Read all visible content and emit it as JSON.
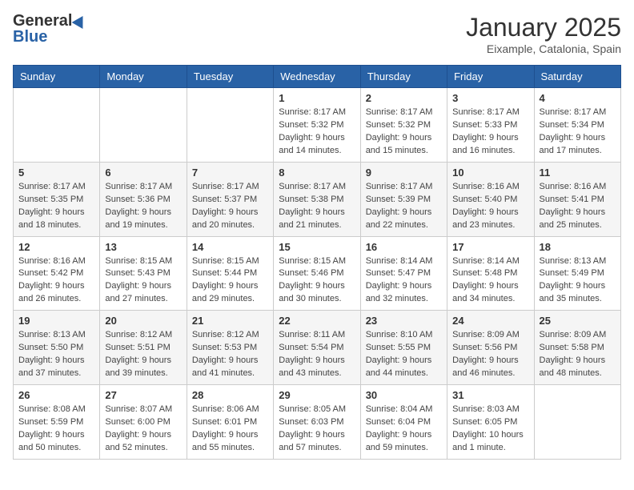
{
  "logo": {
    "general": "General",
    "blue": "Blue"
  },
  "header": {
    "month": "January 2025",
    "location": "Eixample, Catalonia, Spain"
  },
  "weekdays": [
    "Sunday",
    "Monday",
    "Tuesday",
    "Wednesday",
    "Thursday",
    "Friday",
    "Saturday"
  ],
  "weeks": [
    [
      {
        "day": "",
        "detail": ""
      },
      {
        "day": "",
        "detail": ""
      },
      {
        "day": "",
        "detail": ""
      },
      {
        "day": "1",
        "detail": "Sunrise: 8:17 AM\nSunset: 5:32 PM\nDaylight: 9 hours\nand 14 minutes."
      },
      {
        "day": "2",
        "detail": "Sunrise: 8:17 AM\nSunset: 5:32 PM\nDaylight: 9 hours\nand 15 minutes."
      },
      {
        "day": "3",
        "detail": "Sunrise: 8:17 AM\nSunset: 5:33 PM\nDaylight: 9 hours\nand 16 minutes."
      },
      {
        "day": "4",
        "detail": "Sunrise: 8:17 AM\nSunset: 5:34 PM\nDaylight: 9 hours\nand 17 minutes."
      }
    ],
    [
      {
        "day": "5",
        "detail": "Sunrise: 8:17 AM\nSunset: 5:35 PM\nDaylight: 9 hours\nand 18 minutes."
      },
      {
        "day": "6",
        "detail": "Sunrise: 8:17 AM\nSunset: 5:36 PM\nDaylight: 9 hours\nand 19 minutes."
      },
      {
        "day": "7",
        "detail": "Sunrise: 8:17 AM\nSunset: 5:37 PM\nDaylight: 9 hours\nand 20 minutes."
      },
      {
        "day": "8",
        "detail": "Sunrise: 8:17 AM\nSunset: 5:38 PM\nDaylight: 9 hours\nand 21 minutes."
      },
      {
        "day": "9",
        "detail": "Sunrise: 8:17 AM\nSunset: 5:39 PM\nDaylight: 9 hours\nand 22 minutes."
      },
      {
        "day": "10",
        "detail": "Sunrise: 8:16 AM\nSunset: 5:40 PM\nDaylight: 9 hours\nand 23 minutes."
      },
      {
        "day": "11",
        "detail": "Sunrise: 8:16 AM\nSunset: 5:41 PM\nDaylight: 9 hours\nand 25 minutes."
      }
    ],
    [
      {
        "day": "12",
        "detail": "Sunrise: 8:16 AM\nSunset: 5:42 PM\nDaylight: 9 hours\nand 26 minutes."
      },
      {
        "day": "13",
        "detail": "Sunrise: 8:15 AM\nSunset: 5:43 PM\nDaylight: 9 hours\nand 27 minutes."
      },
      {
        "day": "14",
        "detail": "Sunrise: 8:15 AM\nSunset: 5:44 PM\nDaylight: 9 hours\nand 29 minutes."
      },
      {
        "day": "15",
        "detail": "Sunrise: 8:15 AM\nSunset: 5:46 PM\nDaylight: 9 hours\nand 30 minutes."
      },
      {
        "day": "16",
        "detail": "Sunrise: 8:14 AM\nSunset: 5:47 PM\nDaylight: 9 hours\nand 32 minutes."
      },
      {
        "day": "17",
        "detail": "Sunrise: 8:14 AM\nSunset: 5:48 PM\nDaylight: 9 hours\nand 34 minutes."
      },
      {
        "day": "18",
        "detail": "Sunrise: 8:13 AM\nSunset: 5:49 PM\nDaylight: 9 hours\nand 35 minutes."
      }
    ],
    [
      {
        "day": "19",
        "detail": "Sunrise: 8:13 AM\nSunset: 5:50 PM\nDaylight: 9 hours\nand 37 minutes."
      },
      {
        "day": "20",
        "detail": "Sunrise: 8:12 AM\nSunset: 5:51 PM\nDaylight: 9 hours\nand 39 minutes."
      },
      {
        "day": "21",
        "detail": "Sunrise: 8:12 AM\nSunset: 5:53 PM\nDaylight: 9 hours\nand 41 minutes."
      },
      {
        "day": "22",
        "detail": "Sunrise: 8:11 AM\nSunset: 5:54 PM\nDaylight: 9 hours\nand 43 minutes."
      },
      {
        "day": "23",
        "detail": "Sunrise: 8:10 AM\nSunset: 5:55 PM\nDaylight: 9 hours\nand 44 minutes."
      },
      {
        "day": "24",
        "detail": "Sunrise: 8:09 AM\nSunset: 5:56 PM\nDaylight: 9 hours\nand 46 minutes."
      },
      {
        "day": "25",
        "detail": "Sunrise: 8:09 AM\nSunset: 5:58 PM\nDaylight: 9 hours\nand 48 minutes."
      }
    ],
    [
      {
        "day": "26",
        "detail": "Sunrise: 8:08 AM\nSunset: 5:59 PM\nDaylight: 9 hours\nand 50 minutes."
      },
      {
        "day": "27",
        "detail": "Sunrise: 8:07 AM\nSunset: 6:00 PM\nDaylight: 9 hours\nand 52 minutes."
      },
      {
        "day": "28",
        "detail": "Sunrise: 8:06 AM\nSunset: 6:01 PM\nDaylight: 9 hours\nand 55 minutes."
      },
      {
        "day": "29",
        "detail": "Sunrise: 8:05 AM\nSunset: 6:03 PM\nDaylight: 9 hours\nand 57 minutes."
      },
      {
        "day": "30",
        "detail": "Sunrise: 8:04 AM\nSunset: 6:04 PM\nDaylight: 9 hours\nand 59 minutes."
      },
      {
        "day": "31",
        "detail": "Sunrise: 8:03 AM\nSunset: 6:05 PM\nDaylight: 10 hours\nand 1 minute."
      },
      {
        "day": "",
        "detail": ""
      }
    ]
  ]
}
